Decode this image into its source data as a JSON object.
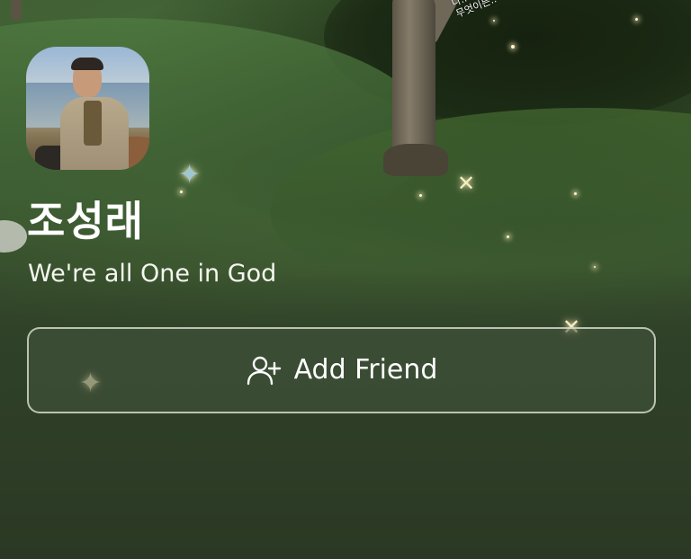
{
  "profile": {
    "name": "조성래",
    "status_message": "We're all One in God",
    "avatar_icon": "profile-photo"
  },
  "background": {
    "overlay_text_line1": "나..  ...심히..",
    "overlay_text_line2": "무엇이든.."
  },
  "actions": {
    "add_friend_label": "Add Friend",
    "add_friend_icon": "person-add-icon"
  },
  "colors": {
    "accent_glow": "#f6ecc0",
    "button_border": "#e6ecde",
    "text": "#ffffff"
  }
}
